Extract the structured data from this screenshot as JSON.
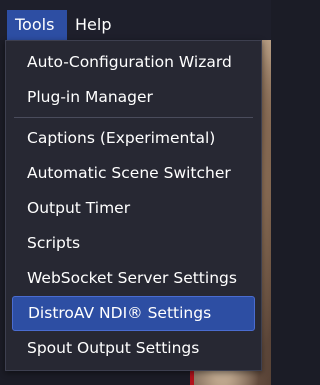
{
  "menubar": {
    "tools_label": "Tools",
    "help_label": "Help"
  },
  "tools_menu": {
    "items": [
      {
        "label": "Auto-Configuration Wizard"
      },
      {
        "label": "Plug-in Manager"
      },
      {
        "label": "Captions (Experimental)"
      },
      {
        "label": "Automatic Scene Switcher"
      },
      {
        "label": "Output Timer"
      },
      {
        "label": "Scripts"
      },
      {
        "label": "WebSocket Server Settings"
      },
      {
        "label": "DistroAV NDI® Settings",
        "selected": true
      },
      {
        "label": "Spout Output Settings"
      }
    ]
  },
  "colors": {
    "menu_background": "#272833",
    "highlight": "#2d4ea3",
    "text": "#ffffff"
  }
}
